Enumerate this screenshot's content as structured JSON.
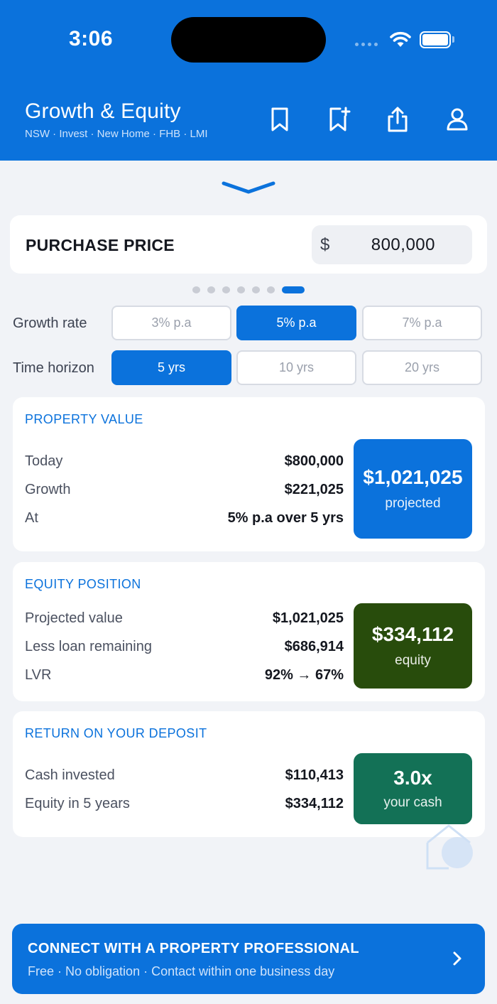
{
  "status_bar": {
    "time": "3:06"
  },
  "header": {
    "title": "Growth & Equity",
    "subtitle": "NSW · Invest · New Home · FHB · LMI",
    "icons": [
      "bookmark-icon",
      "bookmark-add-icon",
      "share-icon",
      "account-icon"
    ]
  },
  "purchase": {
    "label": "PURCHASE PRICE",
    "currency": "$",
    "value": "800,000"
  },
  "pager": {
    "pages": 7,
    "active_index": 6
  },
  "growth_rate": {
    "label": "Growth rate",
    "options": [
      "3% p.a",
      "5% p.a",
      "7% p.a"
    ],
    "selected": "5% p.a"
  },
  "time_horizon": {
    "label": "Time horizon",
    "options": [
      "5 yrs",
      "10 yrs",
      "20 yrs"
    ],
    "selected": "5 yrs"
  },
  "property_value": {
    "title": "PROPERTY VALUE",
    "rows": [
      {
        "label": "Today",
        "value": "$800,000"
      },
      {
        "label": "Growth",
        "value": "$221,025"
      },
      {
        "label": "At",
        "value": "5% p.a over 5 yrs"
      }
    ],
    "highlight": {
      "value": "$1,021,025",
      "caption": "projected",
      "color": "#0b72dc"
    }
  },
  "equity_position": {
    "title": "EQUITY POSITION",
    "rows": [
      {
        "label": "Projected value",
        "value": "$1,021,025"
      },
      {
        "label": "Less loan remaining",
        "value": "$686,914"
      },
      {
        "label": "LVR",
        "value": "92% → 67%"
      }
    ],
    "highlight": {
      "value": "$334,112",
      "caption": "equity",
      "color": "#284c0c"
    }
  },
  "return_on_deposit": {
    "title": "RETURN ON YOUR DEPOSIT",
    "rows": [
      {
        "label": "Cash invested",
        "value": "$110,413"
      },
      {
        "label": "Equity in 5 years",
        "value": "$334,112"
      }
    ],
    "highlight": {
      "value": "3.0x",
      "caption": "your cash",
      "color": "#137156"
    }
  },
  "cta": {
    "title": "CONNECT WITH A PROPERTY PROFESSIONAL",
    "subtitle": "Free · No obligation · Contact within one business day"
  },
  "colors": {
    "brand": "#0b72dc",
    "equity_green": "#284c0c",
    "return_green": "#137156",
    "background": "#f1f3f7"
  }
}
